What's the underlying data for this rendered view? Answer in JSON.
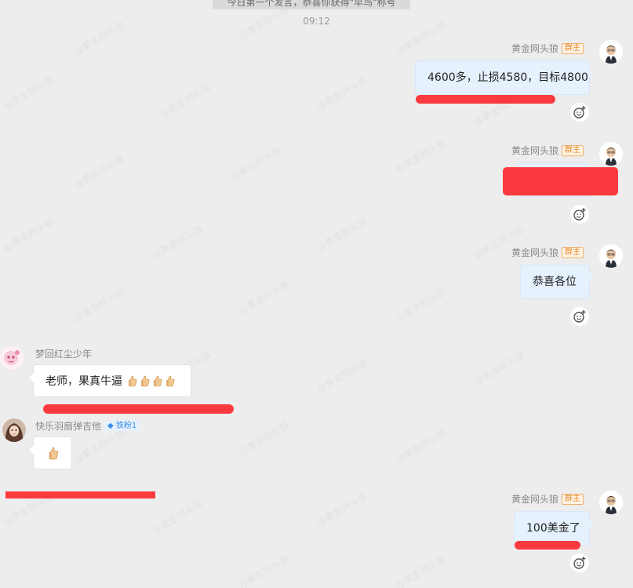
{
  "notice": "今日第一个发言，恭喜你获得\"早鸟\"称号",
  "time": "09:12",
  "watermark": "@黄金网头狼",
  "colors": {
    "redact": "#fa3a3f",
    "my_bubble": "#e5f1fd",
    "other_bubble": "#ffffff"
  },
  "messages": [
    {
      "sender": "黄金网头狼",
      "role": "群主",
      "text": "4600多，止损4580，目标4800"
    },
    {
      "sender": "黄金网头狼",
      "role": "群主",
      "text": ""
    },
    {
      "sender": "黄金网头狼",
      "role": "群主",
      "text": "恭喜各位"
    },
    {
      "sender": "梦回红尘少年",
      "text": "老师，果真牛逼",
      "emoji": [
        "thumbs-up-icon",
        "thumbs-up-icon",
        "thumbs-up-icon",
        "thumbs-up-icon"
      ]
    },
    {
      "sender": "快乐羽扇弹吉他",
      "fan_badge": "铁粉1",
      "emoji": [
        "thumbs-up-icon"
      ]
    },
    {
      "sender": "黄金网头狼",
      "role": "群主",
      "text": "100美金了"
    }
  ]
}
